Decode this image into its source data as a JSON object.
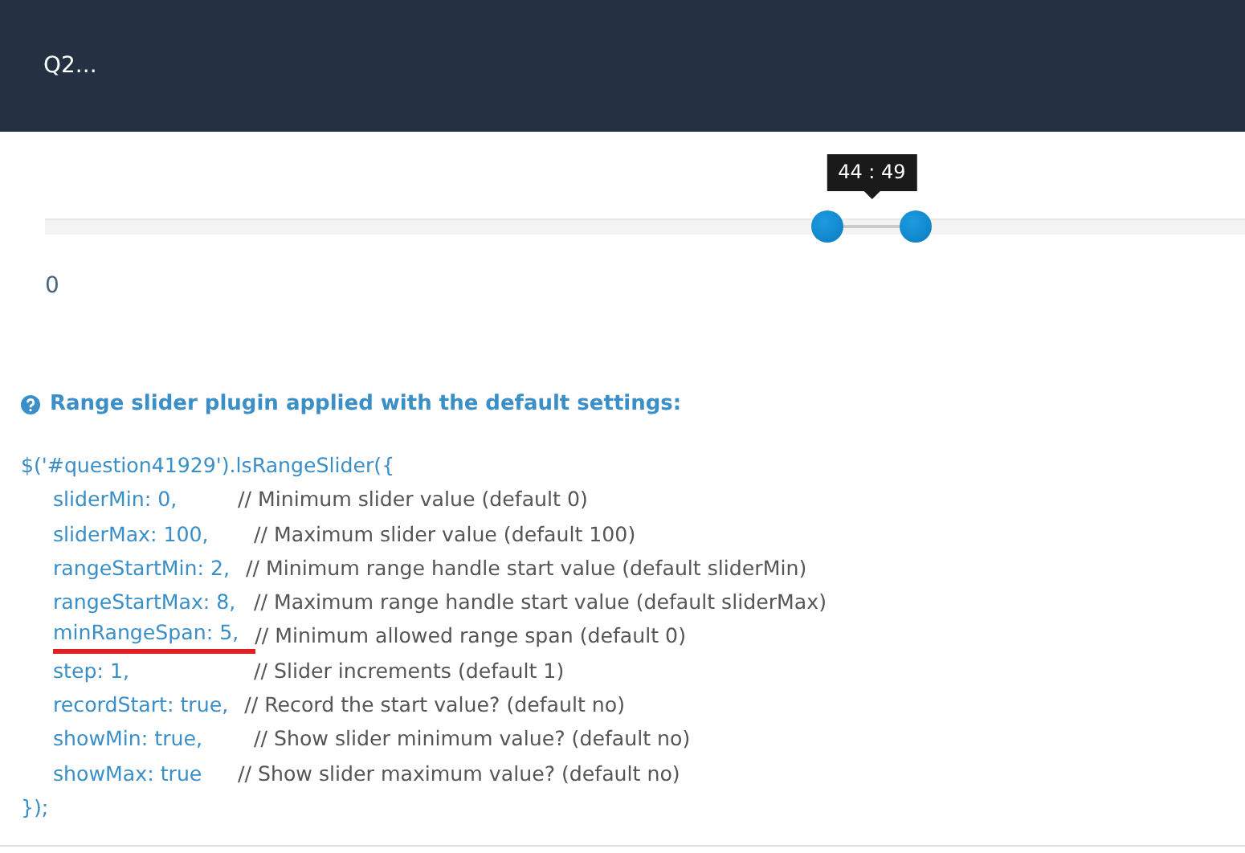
{
  "header": {
    "title": "Q2..."
  },
  "slider": {
    "tooltip": "44 : 49",
    "handles": [
      {
        "level": 0.652
      },
      {
        "level": 0.726
      }
    ],
    "min_label": "0"
  },
  "help": {
    "title": "Range slider plugin applied with the default settings:"
  },
  "code": {
    "opening": "$('#question41929').lsRangeSlider({",
    "lines": [
      {
        "setting": "sliderMin: 0,",
        "comment": "// Minimum slider value (default 0)",
        "underlined": false
      },
      {
        "setting": "sliderMax: 100,",
        "comment": "// Maximum slider value (default 100)",
        "underlined": false
      },
      {
        "setting": "rangeStartMin: 2,",
        "comment": "// Minimum range handle start value (default sliderMin)",
        "underlined": false
      },
      {
        "setting": "rangeStartMax: 8,",
        "comment": "// Maximum range handle start value (default sliderMax)",
        "underlined": false
      },
      {
        "setting": "minRangeSpan: 5,",
        "comment": "// Minimum allowed range span (default 0)",
        "underlined": true
      },
      {
        "setting": "step: 1,",
        "comment": "// Slider increments (default 1)",
        "underlined": false
      },
      {
        "setting": "recordStart: true,",
        "comment": "// Record the start value? (default no)",
        "underlined": false
      },
      {
        "setting": "showMin: true,",
        "comment": "// Show slider minimum value? (default no)",
        "underlined": false
      },
      {
        "setting": "showMax: true",
        "comment": "// Show slider maximum value? (default no)",
        "underlined": false
      }
    ],
    "closing": "});"
  }
}
